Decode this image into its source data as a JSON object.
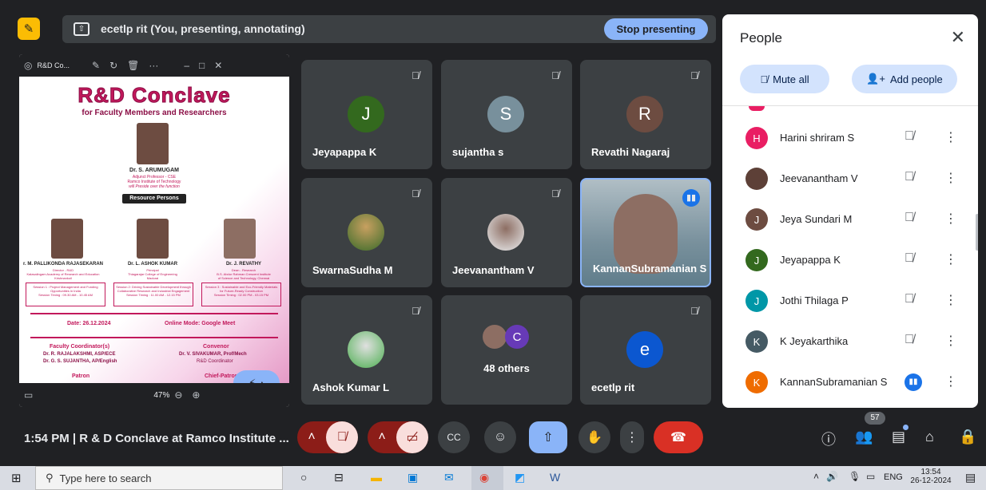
{
  "presenting": {
    "text": "ecetlp rit (You, presenting, annotating)",
    "stop_label": "Stop presenting"
  },
  "slide": {
    "window_title": "R&D Co...",
    "zoom": "47%",
    "heading": "R&D Conclave",
    "subheading": "for Faculty Members and Researchers",
    "chief": {
      "name": "Dr. S. ARUMUGAM",
      "role": "Adjunct Professor - CSE",
      "org": "Ramco Institute of Technology",
      "note": "will Preside over the function"
    },
    "resource_label": "Resource Persons",
    "persons": [
      {
        "name": "r. M. PALLIKONDA RAJASEKARAN",
        "role": "Director - R&D",
        "org": "Kalasalingam Academy of Research and Education",
        "place": "Krishnankoil"
      },
      {
        "name": "Dr. L. ASHOK KUMAR",
        "role": "Principal",
        "org": "Thiagarajar College of Engineering",
        "place": "Madurai"
      },
      {
        "name": "Dr. J. REVATHY",
        "role": "Dean - Research",
        "org": "B.S. Abdur Rahman Crescent Institute",
        "place": "of Science and Technology, Chennai"
      }
    ],
    "sessions": [
      {
        "title": "Session 1 : Project Management and Funding Opportunities in India",
        "timing": "Session Timing : 09.30 AM - 10.45 AM"
      },
      {
        "title": "Session 2: Driving Sustainable Development through Collaborative Research and Industrial Engagement",
        "timing": "Session Timing : 11.00 AM - 12.15 PM"
      },
      {
        "title": "Session 3 : Sustainable and Eco-Friendly Materials for Future-Ready Construction",
        "timing": "Session Timing : 02.00 PM - 03.15 PM"
      }
    ],
    "date": "Date: 26.12.2024",
    "mode": "Online Mode: Google Meet",
    "faculty_coord_label": "Faculty Coordinator(s)",
    "coord1": "Dr. R. RAJALAKSHMI, ASP/ECE",
    "coord2": "Dr. G. S. SUJANTHA, AP/English",
    "convenor_label": "Convenor",
    "convenor": "Dr. V. SIVAKUMAR, Prof/Mech",
    "convenor_role": "R&D Coordinator",
    "patron_label": "Patron",
    "chief_patron_label": "Chief-Patron"
  },
  "tiles": [
    {
      "name": "Jeyapappa K",
      "initial": "J",
      "color": "#33691e"
    },
    {
      "name": "sujantha s",
      "initial": "S",
      "color": "#78909c"
    },
    {
      "name": "Revathi Nagaraj",
      "initial": "R",
      "color": "#6d4c41"
    },
    {
      "name": "SwarnaSudha M"
    },
    {
      "name": "Jeevanantham V"
    },
    {
      "name": "KannanSubramanian S"
    },
    {
      "name": "Ashok Kumar L"
    },
    {
      "name": "48 others",
      "initial": "C"
    },
    {
      "name": "ecetlp rit",
      "initial": "e",
      "color": "#0b57d0"
    }
  ],
  "people": {
    "title": "People",
    "mute_all": "Mute all",
    "add_people": "Add people",
    "list": [
      {
        "name": "Harini shriram S",
        "initial": "H",
        "color": "#e91e63"
      },
      {
        "name": "Jeevanantham V",
        "initial": "",
        "color": "#5d4037"
      },
      {
        "name": "Jeya Sundari M",
        "initial": "J",
        "color": "#6d4c41"
      },
      {
        "name": "Jeyapappa K",
        "initial": "J",
        "color": "#33691e"
      },
      {
        "name": "Jothi Thilaga P",
        "initial": "J",
        "color": "#0097a7"
      },
      {
        "name": "K Jeyakarthika",
        "initial": "K",
        "color": "#455a64"
      },
      {
        "name": "KannanSubramanian S",
        "initial": "K",
        "color": "#ef6c00"
      }
    ]
  },
  "meeting": {
    "time_title": "1:54 PM  |  R & D Conclave at Ramco Institute ...",
    "participant_count": "57"
  },
  "taskbar": {
    "search_placeholder": "Type here to search",
    "lang": "ENG",
    "time": "13:54",
    "date": "26-12-2024"
  }
}
